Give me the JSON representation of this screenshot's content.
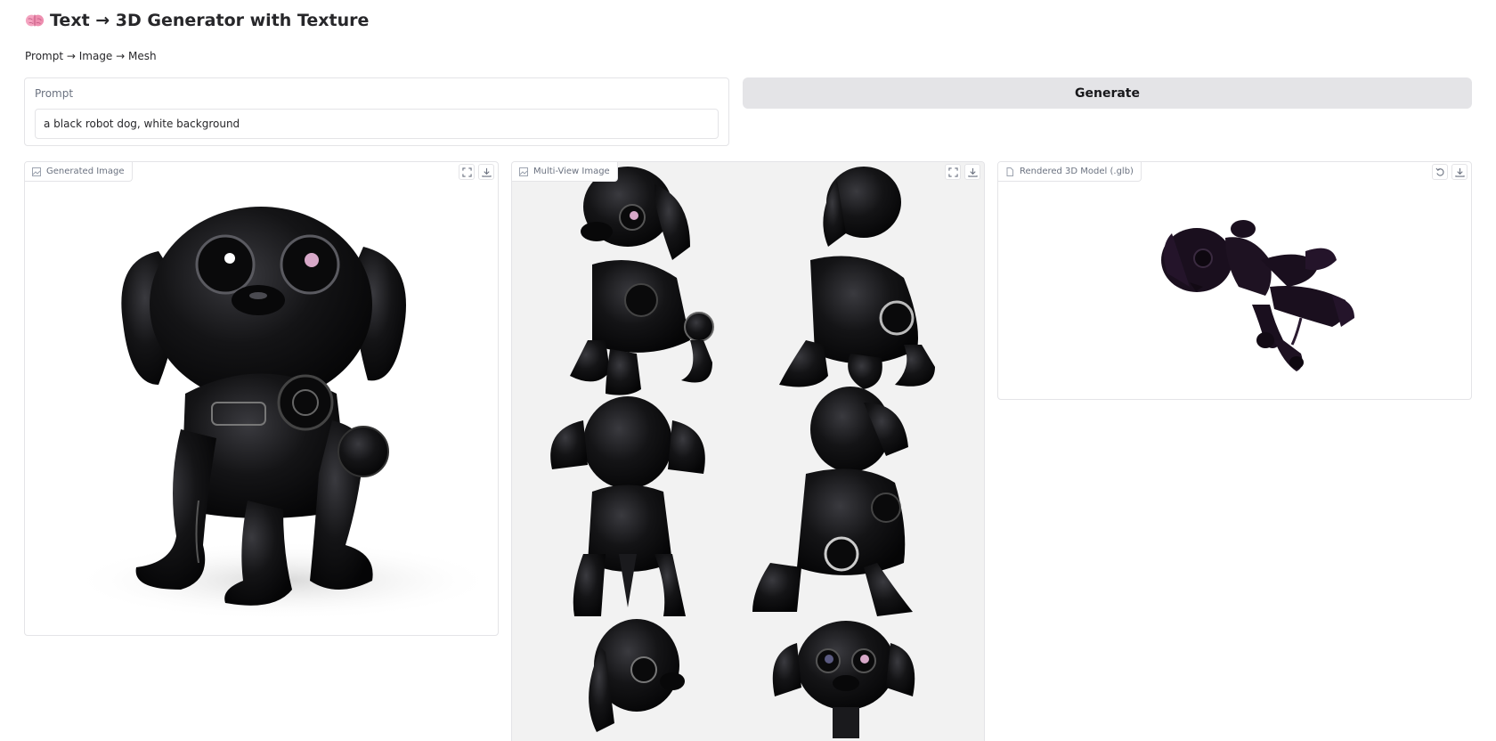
{
  "app": {
    "title": "Text → 3D Generator with Texture",
    "title_icon": "brain-icon",
    "subtitle": "Prompt → Image → Mesh"
  },
  "prompt": {
    "label": "Prompt",
    "value": "a black robot dog, white background"
  },
  "generate_button": {
    "label": "Generate"
  },
  "panels": {
    "generated": {
      "label": "Generated Image",
      "icon": "image-icon",
      "tools": [
        "fullscreen-icon",
        "download-icon"
      ]
    },
    "multiview": {
      "label": "Multi-View Image",
      "icon": "image-icon",
      "tools": [
        "fullscreen-icon",
        "download-icon"
      ]
    },
    "model": {
      "label": "Rendered 3D Model (.glb)",
      "icon": "file-icon",
      "tools": [
        "undo-icon",
        "download-icon"
      ]
    }
  },
  "colors": {
    "button_bg": "#e4e4e7",
    "border": "#e4e4e7",
    "muted_text": "#6b7280",
    "robot_black": "#0d0d0f",
    "model_purple": "#1a0f1e"
  }
}
